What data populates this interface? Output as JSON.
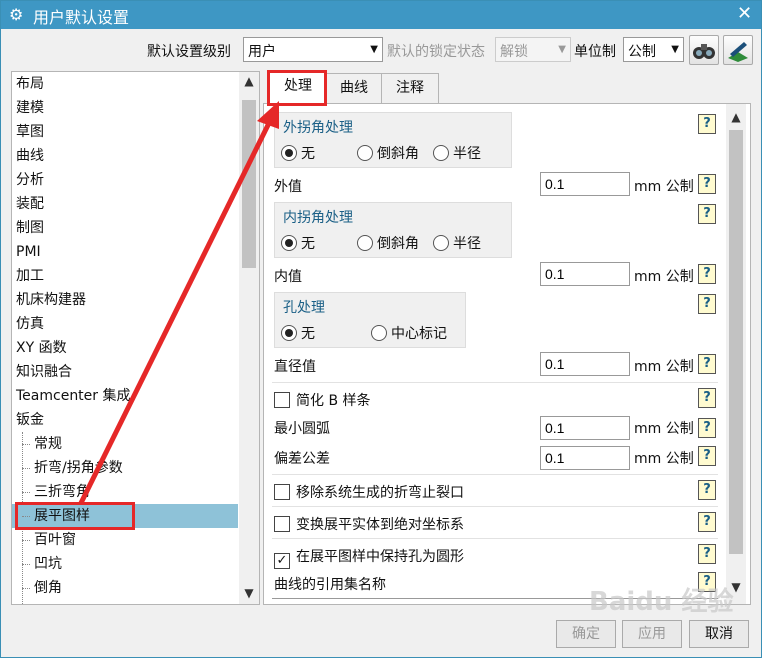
{
  "window": {
    "title": "用户默认设置",
    "close": "✕"
  },
  "toolbar": {
    "level_label": "默认设置级别",
    "level_value": "用户",
    "lock_label": "默认的锁定状态",
    "lock_value": "解锁",
    "unit_label": "单位制",
    "unit_value": "公制"
  },
  "sidebar": {
    "items": [
      "布局",
      "建模",
      "草图",
      "曲线",
      "分析",
      "装配",
      "制图",
      "PMI",
      "加工",
      "机床构建器",
      "仿真",
      "XY 函数",
      "知识融合",
      "Teamcenter 集成",
      "钣金"
    ],
    "subitems": [
      "常规",
      "折弯/拐角参数",
      "三折弯角",
      "展平图样",
      "百叶窗",
      "凹坑",
      "倒角"
    ],
    "selected": "展平图样"
  },
  "tabs": [
    "处理",
    "曲线",
    "注释"
  ],
  "content": {
    "outer_group": {
      "title": "外拐角处理",
      "options": [
        "无",
        "倒斜角",
        "半径"
      ]
    },
    "outer_value": {
      "label": "外值",
      "value": "0.1",
      "unit": "mm",
      "unit_system": "公制"
    },
    "inner_group": {
      "title": "内拐角处理",
      "options": [
        "无",
        "倒斜角",
        "半径"
      ]
    },
    "inner_value": {
      "label": "内值",
      "value": "0.1",
      "unit": "mm",
      "unit_system": "公制"
    },
    "hole_group": {
      "title": "孔处理",
      "options": [
        "无",
        "中心标记"
      ]
    },
    "diameter_value": {
      "label": "直径值",
      "value": "0.1",
      "unit": "mm",
      "unit_system": "公制"
    },
    "simplify_bspline": {
      "label": "简化 B 样条",
      "checked": false
    },
    "min_arc": {
      "label": "最小圆弧",
      "value": "0.1",
      "unit": "mm",
      "unit_system": "公制"
    },
    "tolerance": {
      "label": "偏差公差",
      "value": "0.1",
      "unit": "mm",
      "unit_system": "公制"
    },
    "remove_relief": {
      "label": "移除系统生成的折弯止裂口",
      "checked": false
    },
    "transform_abs": {
      "label": "变换展平实体到绝对坐标系",
      "checked": false
    },
    "keep_holes": {
      "label": "在展平图样中保持孔为圆形",
      "checked": true
    },
    "curve_refset": {
      "label": "曲线的引用集名称"
    },
    "help_glyph": "?"
  },
  "buttons": {
    "ok": "确定",
    "apply": "应用",
    "cancel": "取消"
  },
  "watermark": "Baidu 经验",
  "colors": {
    "titlebar": "#3e97c4",
    "selected": "#8ec2d8",
    "annotation": "#e52828",
    "group_title": "#1a5f86"
  }
}
